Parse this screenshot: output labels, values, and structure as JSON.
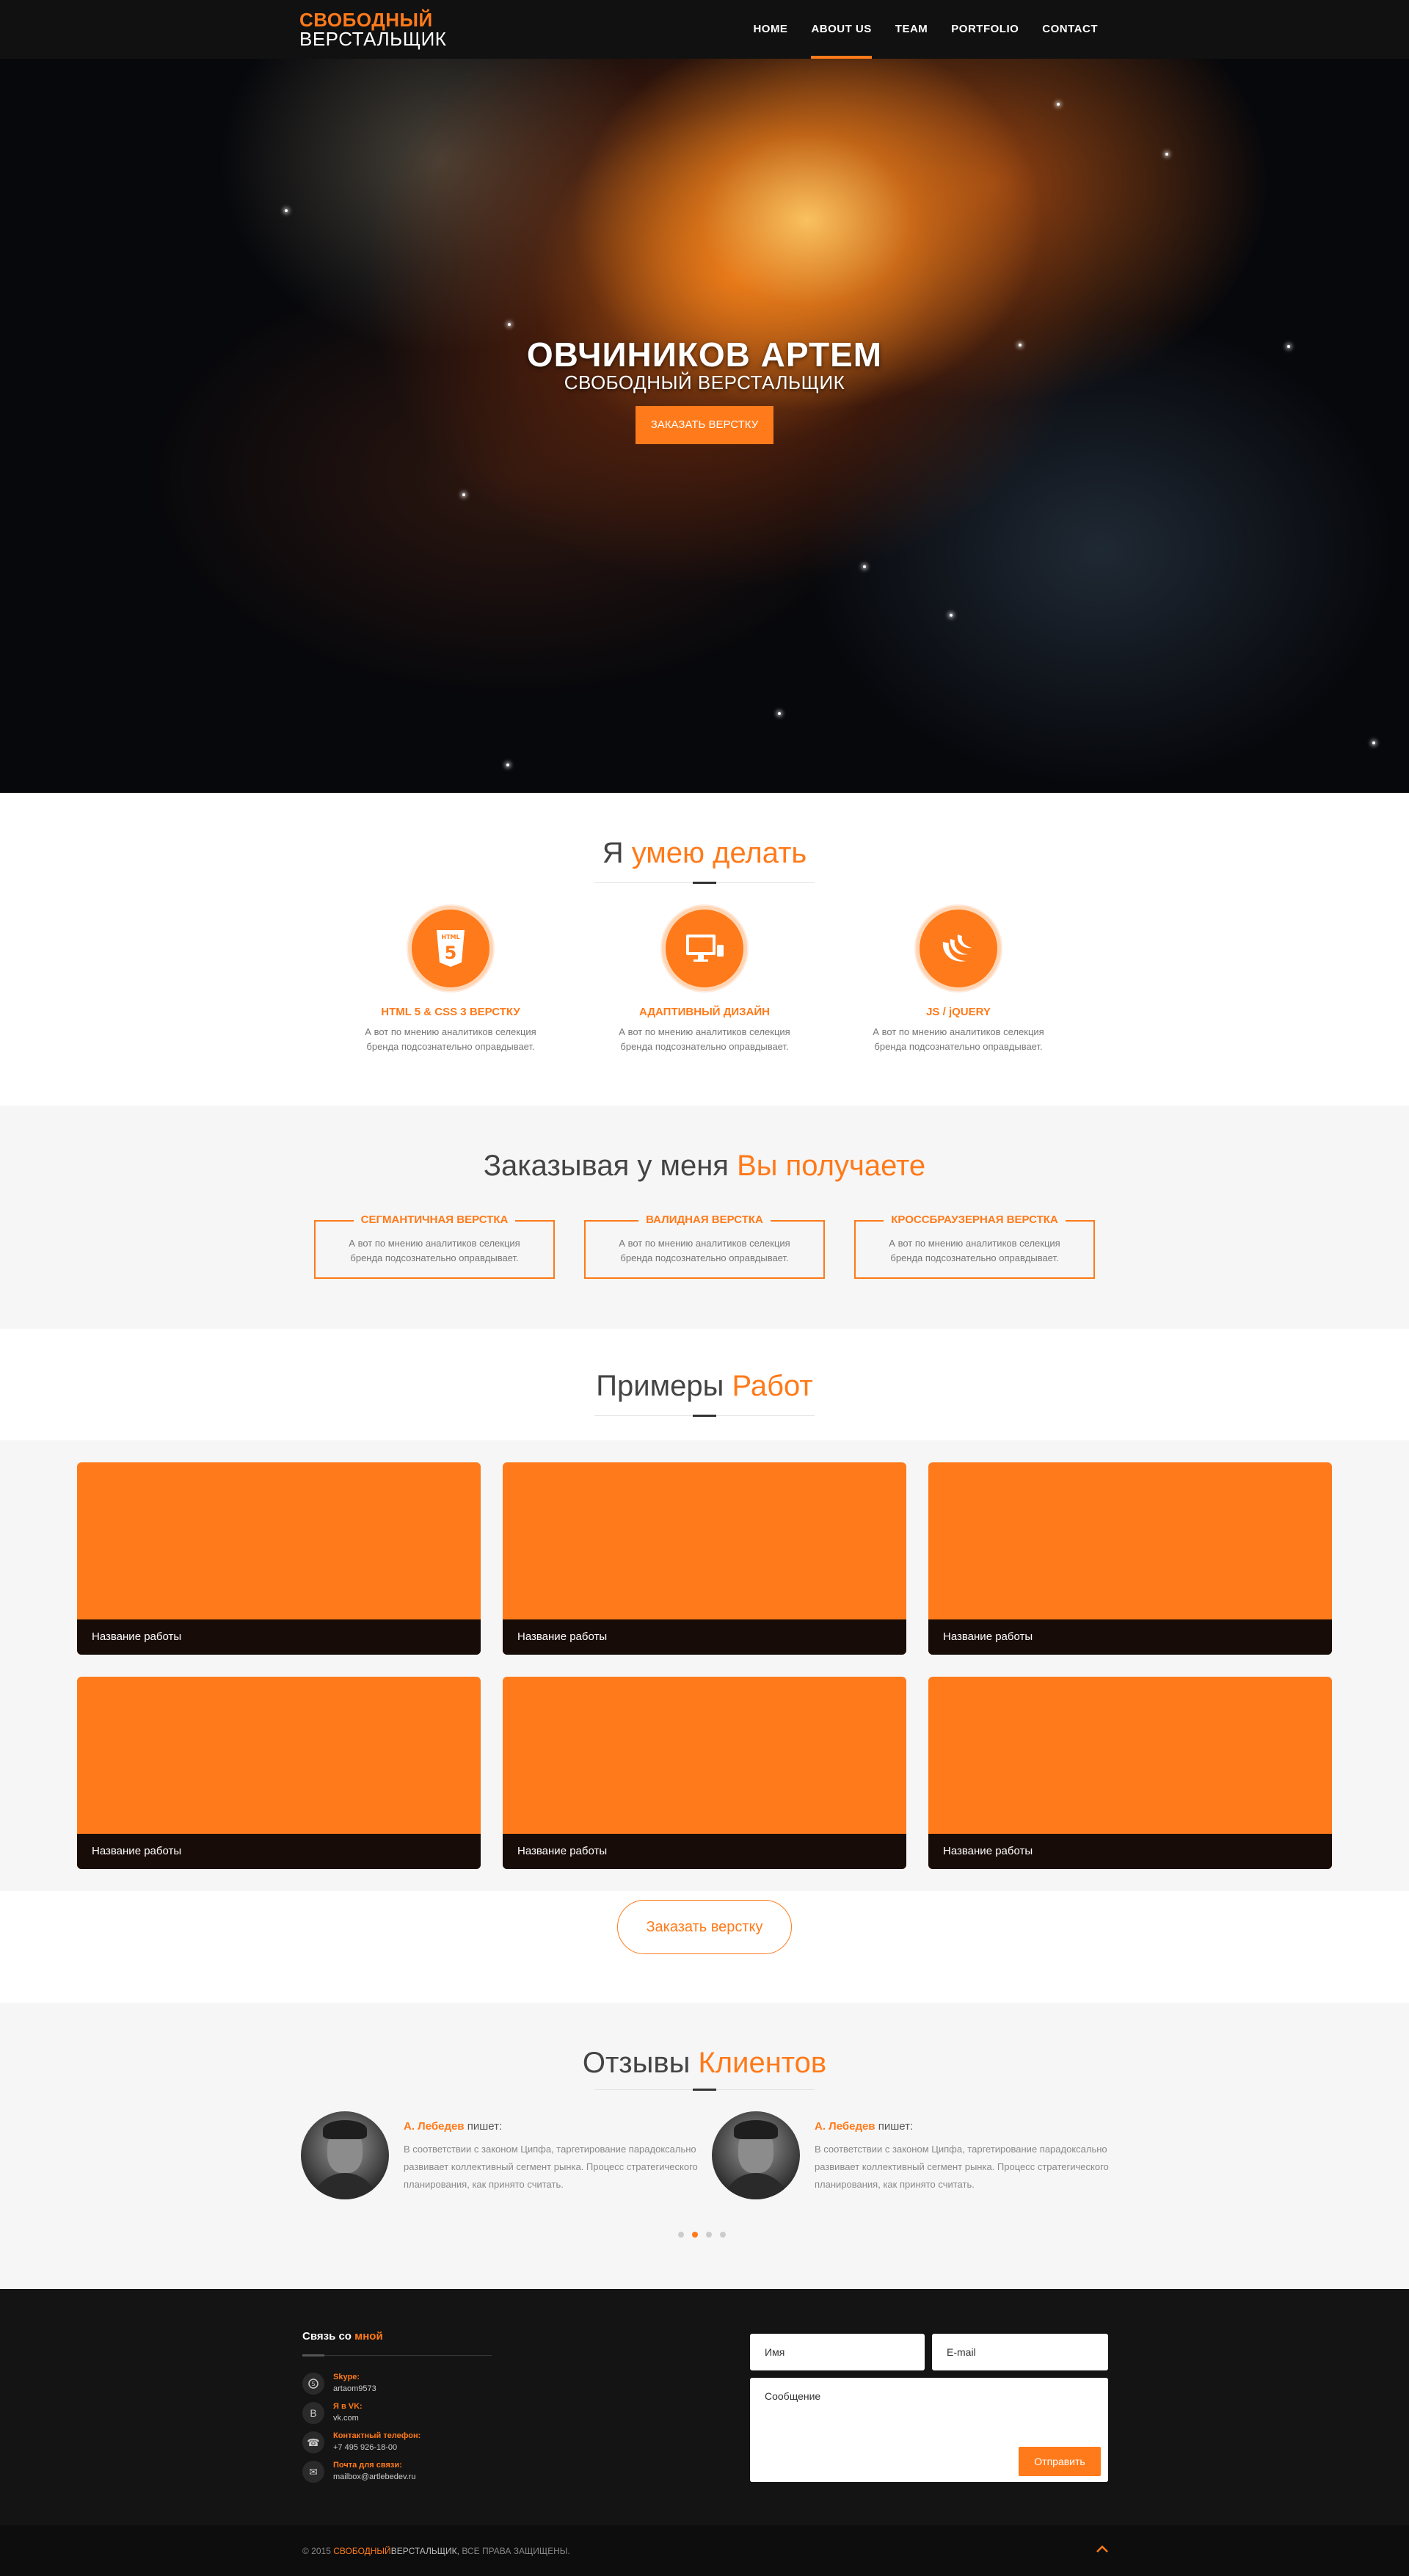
{
  "header": {
    "logo_line1": "СВОБОДНЫЙ",
    "logo_line2": "ВЕРСТАЛЬЩИК",
    "nav": [
      "HOME",
      "ABOUT US",
      "TEAM",
      "PORTFOLIO",
      "CONTACT"
    ],
    "nav_active": "ABOUT US"
  },
  "hero": {
    "title": "ОВЧИНИКОВ АРТЕМ",
    "subtitle": "СВОБОДНЫЙ ВЕРСТАЛЬЩИК",
    "button": "ЗАКАЗАТЬ ВЕРСТКУ"
  },
  "skills": {
    "title_plain": "Я",
    "title_accent": "умею делать",
    "items": [
      {
        "icon": "html5-icon",
        "title": "HTML 5 & CSS 3 ВЕРСТКУ",
        "text": "А вот по мнению аналитиков селекция бренда подсознательно оправдывает."
      },
      {
        "icon": "monitor-icon",
        "title": "АДАПТИВНЫЙ ДИЗАЙН",
        "text": "А вот по мнению аналитиков селекция бренда подсознательно оправдывает."
      },
      {
        "icon": "jquery-icon",
        "title": "JS / jQUERY",
        "text": "А вот по мнению аналитиков селекция бренда подсознательно оправдывает."
      }
    ]
  },
  "benefits": {
    "title_plain": "Заказывая у меня",
    "title_accent": "Вы получаете",
    "items": [
      {
        "title": "СЕГМАНТИЧНАЯ ВЕРСТКА",
        "text": "А вот по мнению аналитиков селекция бренда подсознательно оправдывает."
      },
      {
        "title": "ВАЛИДНАЯ ВЕРСТКА",
        "text": "А вот по мнению аналитиков селекция бренда подсознательно оправдывает."
      },
      {
        "title": "КРОССБРАУЗЕРНАЯ ВЕРСТКА",
        "text": "А вот по мнению аналитиков селекция бренда подсознательно оправдывает."
      }
    ]
  },
  "portfolio": {
    "title_plain": "Примеры",
    "title_accent": "Работ",
    "works": [
      "Название работы",
      "Название работы",
      "Название работы",
      "Название работы",
      "Название работы",
      "Название работы"
    ],
    "order_button": "Заказать верстку"
  },
  "testimonials": {
    "title_plain": "Отзывы",
    "title_accent": "Клиентов",
    "reviews": [
      {
        "author": "А. Лебедев",
        "suffix": "пишет:",
        "text": "В соответствии с законом Ципфа, таргетирование парадоксально развивает коллективный сегмент рынка. Процесс стратегического планирования, как принято считать."
      },
      {
        "author": "А. Лебедев",
        "suffix": "пишет:",
        "text": "В соответствии с законом Ципфа, таргетирование парадоксально развивает коллективный сегмент рынка. Процесс стратегического планирования, как принято считать."
      }
    ],
    "dots": 4,
    "active_dot": 1
  },
  "contact": {
    "title_plain": "Связь со",
    "title_accent": "мной",
    "items": [
      {
        "icon": "skype-icon",
        "label": "Skype:",
        "value": "artaom9573"
      },
      {
        "icon": "vk-icon",
        "label": "Я в VK:",
        "value": "vk.com"
      },
      {
        "icon": "phone-icon",
        "label": "Контактный телефон:",
        "value": "+7 495 926-18-00"
      },
      {
        "icon": "mail-icon",
        "label": "Почта для связи:",
        "value": "mailbox@artlebedev.ru"
      }
    ],
    "form": {
      "name_placeholder": "Имя",
      "email_placeholder": "E-mail",
      "message_placeholder": "Сообщение",
      "send_button": "Отправить"
    }
  },
  "footer": {
    "copy_prefix": "© 2015",
    "brand": "СВОБОДНЫЙ",
    "brand_rest": "ВЕРСТАЛЬЩИК,",
    "rights": "ВСЕ ПРАВА ЗАЩИЩЕНЫ."
  },
  "colors": {
    "accent": "#ff7a1a",
    "dark": "#141414",
    "light_bg": "#f6f6f6"
  }
}
